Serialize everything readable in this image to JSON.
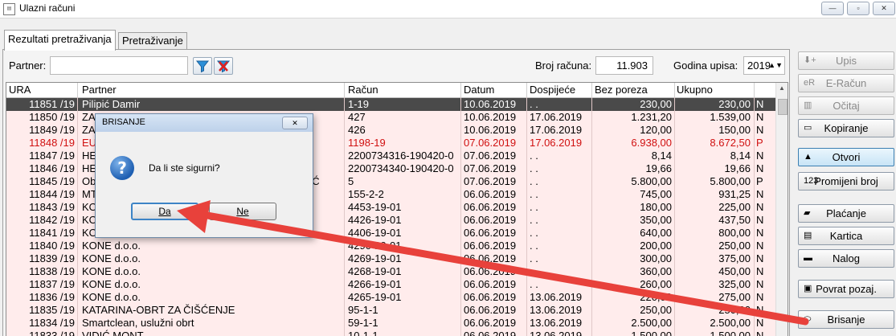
{
  "window": {
    "title": "Ulazni računi",
    "min_glyph": "—",
    "max_glyph": "▫",
    "close_glyph": "✕"
  },
  "tabs": [
    {
      "label": "Rezultati pretraživanja"
    },
    {
      "label": "Pretraživanje"
    }
  ],
  "search": {
    "partner_label": "Partner:",
    "partner_value": "",
    "broj_label": "Broj računa:",
    "broj_value": "11.903",
    "godina_label": "Godina upisa:",
    "godina_value": "2019"
  },
  "columns": [
    "URA",
    "Partner",
    "Račun",
    "Datum",
    "Dospijeće",
    "Bez poreza",
    "Ukupno"
  ],
  "rows": [
    {
      "ura": "11851 /19",
      "partner": "Pilipić Damir",
      "racun": "1-19",
      "datum": "10.06.2019",
      "dosp": ". .",
      "bez": "230,00",
      "uk": "230,00",
      "s": "N"
    },
    {
      "ura": "11850 /19",
      "partner": "ZA",
      "racun": "427",
      "datum": "10.06.2019",
      "dosp": "17.06.2019",
      "bez": "1.231,20",
      "uk": "1.539,00",
      "s": "N"
    },
    {
      "ura": "11849 /19",
      "partner": "ZA",
      "racun": "426",
      "datum": "10.06.2019",
      "dosp": "17.06.2019",
      "bez": "120,00",
      "uk": "150,00",
      "s": "N"
    },
    {
      "ura": "11848 /19",
      "partner": "EU",
      "racun": "1198-19",
      "datum": "07.06.2019",
      "dosp": "17.06.2019",
      "bez": "6.938,00",
      "uk": "8.672,50",
      "s": "P"
    },
    {
      "ura": "11847 /19",
      "partner": "HE",
      "racun": "2200734316-190420-0",
      "datum": "07.06.2019",
      "dosp": ". .",
      "bez": "8,14",
      "uk": "8,14",
      "s": "N"
    },
    {
      "ura": "11846 /19",
      "partner": "HE",
      "racun": "2200734340-190420-0",
      "datum": "07.06.2019",
      "dosp": ". .",
      "bez": "19,66",
      "uk": "19,66",
      "s": "N"
    },
    {
      "ura": "11845 /19",
      "partner": "Ob",
      "partner_tail": "VIĆ",
      "racun": "5",
      "datum": "07.06.2019",
      "dosp": ". .",
      "bez": "5.800,00",
      "uk": "5.800,00",
      "s": "P"
    },
    {
      "ura": "11844 /19",
      "partner": "MT",
      "racun": "155-2-2",
      "datum": "06.06.2019",
      "dosp": ". .",
      "bez": "745,00",
      "uk": "931,25",
      "s": "N"
    },
    {
      "ura": "11843 /19",
      "partner": "KO",
      "racun": "4453-19-01",
      "datum": "06.06.2019",
      "dosp": ". .",
      "bez": "180,00",
      "uk": "225,00",
      "s": "N"
    },
    {
      "ura": "11842 /19",
      "partner": "KO",
      "racun": "4426-19-01",
      "datum": "06.06.2019",
      "dosp": ". .",
      "bez": "350,00",
      "uk": "437,50",
      "s": "N"
    },
    {
      "ura": "11841 /19",
      "partner": "KO",
      "racun": "4406-19-01",
      "datum": "06.06.2019",
      "dosp": ". .",
      "bez": "640,00",
      "uk": "800,00",
      "s": "N"
    },
    {
      "ura": "11840 /19",
      "partner": "KONE d.o.o.",
      "racun": "4290-19-01",
      "datum": "06.06.2019",
      "dosp": ". .",
      "bez": "200,00",
      "uk": "250,00",
      "s": "N"
    },
    {
      "ura": "11839 /19",
      "partner": "KONE d.o.o.",
      "racun": "4269-19-01",
      "datum": "06.06.2019",
      "dosp": ". .",
      "bez": "300,00",
      "uk": "375,00",
      "s": "N"
    },
    {
      "ura": "11838 /19",
      "partner": "KONE d.o.o.",
      "racun": "4268-19-01",
      "datum": "06.06.2019",
      "dosp": ". .",
      "bez": "360,00",
      "uk": "450,00",
      "s": "N"
    },
    {
      "ura": "11837 /19",
      "partner": "KONE d.o.o.",
      "racun": "4266-19-01",
      "datum": "06.06.2019",
      "dosp": ". .",
      "bez": "260,00",
      "uk": "325,00",
      "s": "N"
    },
    {
      "ura": "11836 /19",
      "partner": "KONE d.o.o.",
      "racun": "4265-19-01",
      "datum": "06.06.2019",
      "dosp": "13.06.2019",
      "bez": "220,00",
      "uk": "275,00",
      "s": "N"
    },
    {
      "ura": "11835 /19",
      "partner": "KATARINA-OBRT ZA ČIŠĆENJE",
      "racun": "95-1-1",
      "datum": "06.06.2019",
      "dosp": "13.06.2019",
      "bez": "250,00",
      "uk": "250,00",
      "s": "N"
    },
    {
      "ura": "11834 /19",
      "partner": "Smartclean, uslužni obrt",
      "racun": "59-1-1",
      "datum": "06.06.2019",
      "dosp": "13.06.2019",
      "bez": "2.500,00",
      "uk": "2.500,00",
      "s": "N"
    },
    {
      "ura": "11833 /19",
      "partner": "VIDIĆ MONT",
      "racun": "10-1-1",
      "datum": "06.06.2019",
      "dosp": "13.06.2019",
      "bez": "1.500,00",
      "uk": "1.500,00",
      "s": "N"
    }
  ],
  "buttons": [
    {
      "label": "Upis",
      "icon": "⬇+"
    },
    {
      "label": "E-Račun",
      "icon": "eR"
    },
    {
      "label": "Očitaj",
      "icon": "▥"
    },
    {
      "label": "Kopiranje",
      "icon": "▭"
    },
    {
      "label": "Otvori",
      "icon": "▲"
    },
    {
      "label": "Promijeni broj",
      "icon": "123"
    },
    {
      "label": "Plaćanje",
      "icon": "▰"
    },
    {
      "label": "Kartica",
      "icon": "▤"
    },
    {
      "label": "Nalog",
      "icon": "▬"
    },
    {
      "label": "Povrat pozaj.",
      "icon": "▣"
    },
    {
      "label": "Brisanje",
      "icon": "⬭"
    }
  ],
  "dialog": {
    "title": "BRISANJE",
    "message": "Da li ste sigurni?",
    "yes": "Da",
    "no": "Ne",
    "close_glyph": "✕",
    "icon_glyph": "?"
  },
  "colors": {
    "arrow": "#e8413b",
    "selected_row": "#4a4a4a",
    "row_bg": "#ffecec",
    "red_text": "#d01010"
  }
}
